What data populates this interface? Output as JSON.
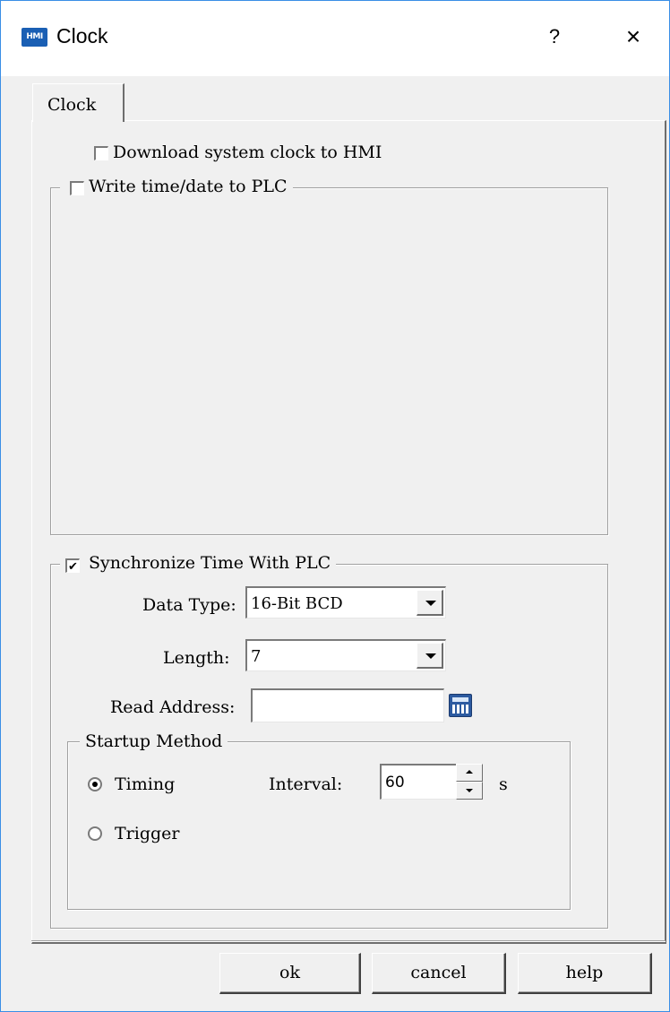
{
  "window": {
    "title": "Clock",
    "icon": "hmi-app-icon",
    "icon_text": "HMI",
    "help_label": "?",
    "close_label": "×"
  },
  "tabs": [
    {
      "label": "Clock",
      "active": true
    }
  ],
  "download_clock": {
    "label": "Download system clock to HMI",
    "checked": false
  },
  "write_group": {
    "label": "Write time/date to PLC",
    "checked": false
  },
  "sync_group": {
    "label": "Synchronize Time With PLC",
    "checked": true,
    "data_type": {
      "label": "Data Type:",
      "value": "16-Bit BCD"
    },
    "length": {
      "label": "Length:",
      "value": "7"
    },
    "read_address": {
      "label": "Read Address:",
      "value": ""
    },
    "startup": {
      "label": "Startup Method",
      "timing": {
        "label": "Timing",
        "selected": true
      },
      "trigger": {
        "label": "Trigger",
        "selected": false
      },
      "interval": {
        "label": "Interval:",
        "value": "60",
        "unit": "s"
      }
    }
  },
  "buttons": {
    "ok": "ok",
    "cancel": "cancel",
    "help": "help"
  },
  "colors": {
    "window_border": "#3a8ee6",
    "dialog_bg": "#f0f0f0",
    "icon_blue": "#1a5fb4"
  }
}
